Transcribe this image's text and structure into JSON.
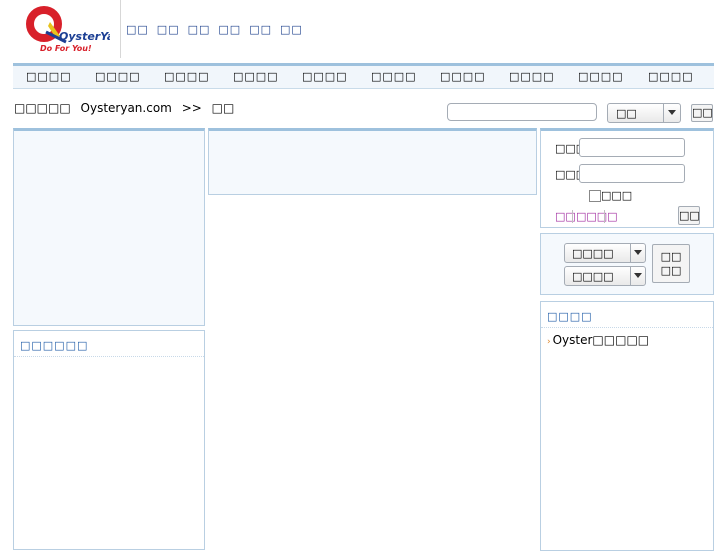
{
  "logo": {
    "brand_text": "OysterYan",
    "slogan": "Do For You!"
  },
  "header": {
    "top_links": [
      "□□",
      "□□",
      "□□",
      "□□",
      "□□",
      "□□"
    ]
  },
  "nav": {
    "items": [
      "□□□□",
      "□□□□",
      "□□□□",
      "□□□□",
      "□□□□",
      "□□□□",
      "□□□□",
      "□□□□",
      "□□□□",
      "□□□□"
    ]
  },
  "breadcrumb": {
    "prefix": "□□□□□",
    "site": "Oysteryan.com",
    "separator": ">>",
    "current": "□□"
  },
  "search": {
    "value": "",
    "select_value": "□□",
    "button_label": "□□"
  },
  "left_bottom_panel": {
    "heading": "□□□□□□"
  },
  "login": {
    "username_label": "□□□",
    "password_label": "□□□",
    "remember_label": "□□□",
    "link_register": "□□",
    "link_forgot": "□□□□",
    "button_label": "□□"
  },
  "quick_select": {
    "select1_value": "□□□□",
    "select2_value": "□□□□",
    "button_line1": "□□",
    "button_line2": "□□"
  },
  "friend_links": {
    "heading": "□□□□",
    "items": [
      "Oyster□□□□□"
    ]
  },
  "colors": {
    "accent": "#9ec1dd",
    "panel_border": "#b9cfe2",
    "link_blue": "#1b3f8b",
    "link_purple": "#a0289f",
    "logo_red": "#d8202a",
    "logo_navy": "#1c3f94"
  }
}
